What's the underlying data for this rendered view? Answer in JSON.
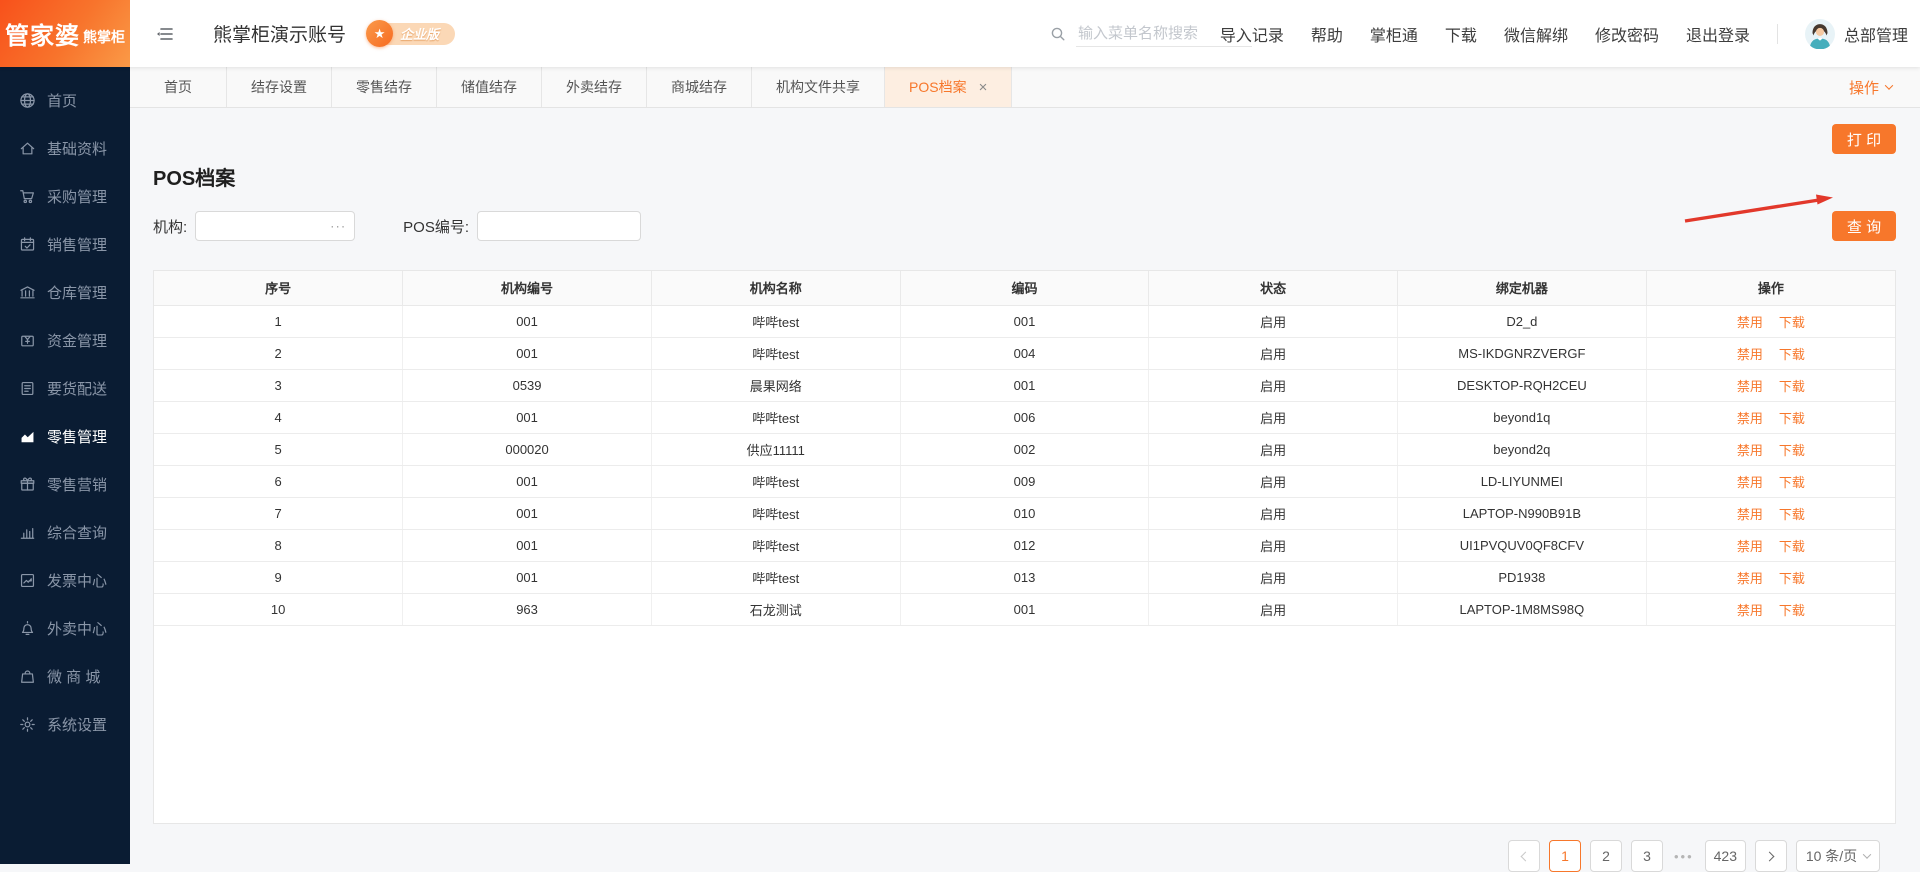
{
  "brand": {
    "logo_main": "管家婆",
    "logo_sub": "熊掌柜"
  },
  "topbar": {
    "account_title": "熊掌柜演示账号",
    "badge_star": "★",
    "badge_label": "企业版",
    "search_placeholder": "输入菜单名称搜索",
    "menu": [
      "导入记录",
      "帮助",
      "掌柜通",
      "下载",
      "微信解绑",
      "修改密码",
      "退出登录"
    ],
    "user_name": "总部管理"
  },
  "sidebar": {
    "items": [
      {
        "icon": "globe",
        "label": "首页"
      },
      {
        "icon": "home",
        "label": "基础资料"
      },
      {
        "icon": "cart",
        "label": "采购管理"
      },
      {
        "icon": "calendar",
        "label": "销售管理"
      },
      {
        "icon": "bank",
        "label": "仓库管理"
      },
      {
        "icon": "fund",
        "label": "资金管理"
      },
      {
        "icon": "doc",
        "label": "要货配送"
      },
      {
        "icon": "area-chart",
        "label": "零售管理",
        "active": true
      },
      {
        "icon": "gift",
        "label": "零售营销"
      },
      {
        "icon": "bar-chart",
        "label": "综合查询"
      },
      {
        "icon": "invoice",
        "label": "发票中心"
      },
      {
        "icon": "bell",
        "label": "外卖中心"
      },
      {
        "icon": "bag",
        "label": "微 商 城"
      },
      {
        "icon": "gear",
        "label": "系统设置"
      }
    ]
  },
  "tabs": {
    "items": [
      "首页",
      "结存设置",
      "零售结存",
      "储值结存",
      "外卖结存",
      "商城结存",
      "机构文件共享",
      "POS档案"
    ],
    "active": "POS档案",
    "close_glyph": "×",
    "actions_label": "操作"
  },
  "page": {
    "title": "POS档案",
    "print_button": "打 印",
    "query_button": "查 询",
    "org_label": "机构:",
    "org_suffix": "···",
    "pos_label": "POS编号:"
  },
  "table": {
    "columns": [
      "序号",
      "机构编号",
      "机构名称",
      "编码",
      "状态",
      "绑定机器",
      "操作"
    ],
    "row_actions": [
      "禁用",
      "下载"
    ],
    "rows": [
      [
        "1",
        "001",
        "哔哔test",
        "001",
        "启用",
        "D2_d"
      ],
      [
        "2",
        "001",
        "哔哔test",
        "004",
        "启用",
        "MS-IKDGNRZVERGF"
      ],
      [
        "3",
        "0539",
        "晨果网络",
        "001",
        "启用",
        "DESKTOP-RQH2CEU"
      ],
      [
        "4",
        "001",
        "哔哔test",
        "006",
        "启用",
        "beyond1q"
      ],
      [
        "5",
        "000020",
        "供应11111",
        "002",
        "启用",
        "beyond2q"
      ],
      [
        "6",
        "001",
        "哔哔test",
        "009",
        "启用",
        "LD-LIYUNMEI"
      ],
      [
        "7",
        "001",
        "哔哔test",
        "010",
        "启用",
        "LAPTOP-N990B91B"
      ],
      [
        "8",
        "001",
        "哔哔test",
        "012",
        "启用",
        "UI1PVQUV0QF8CFV"
      ],
      [
        "9",
        "001",
        "哔哔test",
        "013",
        "启用",
        "PD1938"
      ],
      [
        "10",
        "963",
        "石龙测试",
        "001",
        "启用",
        "LAPTOP-1M8MS98Q"
      ]
    ]
  },
  "pagination": {
    "pages": [
      "1",
      "2",
      "3"
    ],
    "active_page": "1",
    "ellipsis": "•••",
    "last_page": "423",
    "page_size": "10 条/页"
  },
  "colors": {
    "accent": "#f7772b",
    "sidebar_bg": "#0a1c33",
    "arrow_red": "#e2382b"
  }
}
